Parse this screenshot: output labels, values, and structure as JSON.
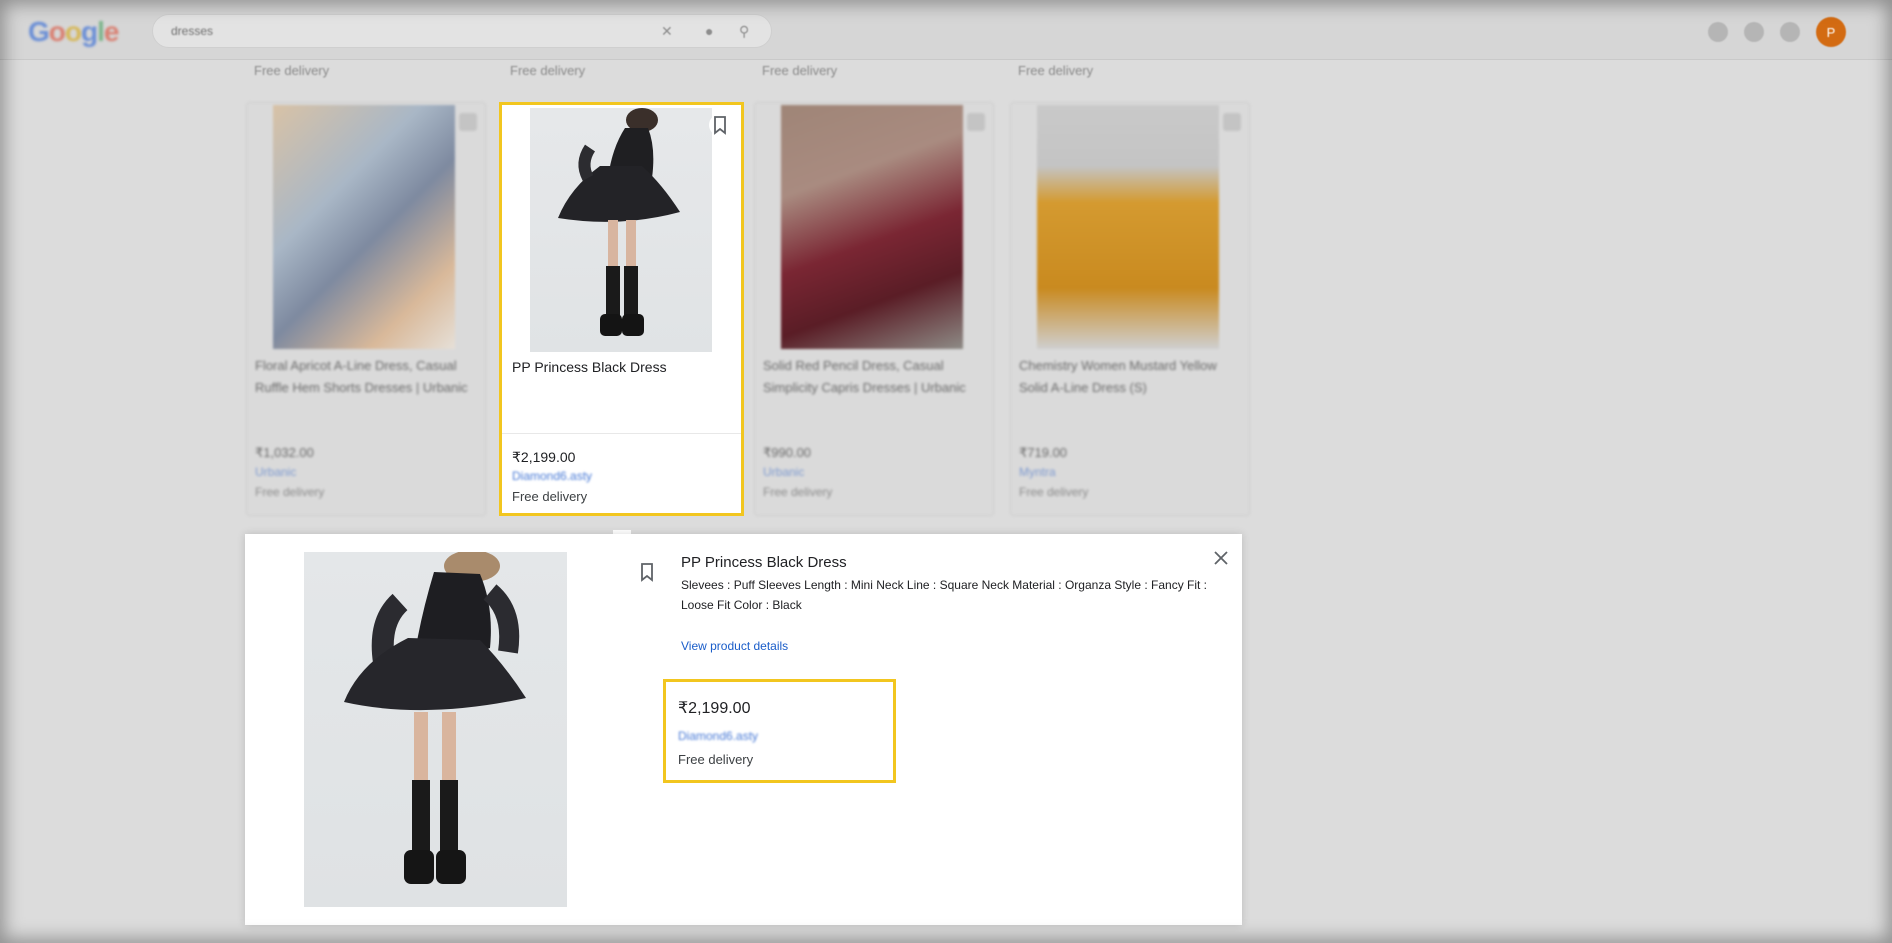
{
  "header": {
    "logo_letters": [
      "G",
      "o",
      "o",
      "g",
      "l",
      "e"
    ],
    "search_query": "dresses",
    "avatar_letter": "P"
  },
  "grid": {
    "top_row": [
      {
        "delivery": "Free delivery"
      },
      {
        "delivery": "Free delivery"
      },
      {
        "delivery": "Free delivery"
      },
      {
        "delivery": "Free delivery"
      }
    ],
    "cards": [
      {
        "title": "Floral Apricot A-Line Dress, Casual Ruffle Hem Shorts Dresses | Urbanic",
        "price": "₹1,032.00",
        "seller": "Urbanic",
        "delivery": "Free delivery",
        "image_tone": "floral"
      },
      {
        "title": "PP Princess Black Dress",
        "price": "₹2,199.00",
        "seller": "Diamond6.asty",
        "delivery": "Free delivery",
        "selected": true
      },
      {
        "title": "Solid Red Pencil Dress, Casual Simplicity Capris Dresses | Urbanic",
        "price": "₹990.00",
        "seller": "Urbanic",
        "delivery": "Free delivery",
        "image_tone": "red"
      },
      {
        "title": "Chemistry Women Mustard Yellow Solid A-Line Dress (S)",
        "price": "₹719.00",
        "seller": "Myntra",
        "delivery": "Free delivery",
        "image_tone": "mustard"
      }
    ]
  },
  "panel": {
    "title": "PP Princess Black Dress",
    "description": "Slevees : Puff Sleeves Length : Mini Neck Line : Square Neck Material : Organza Style : Fancy Fit : Loose Fit Color : Black",
    "view_details": "View product details",
    "offer": {
      "price": "₹2,199.00",
      "seller": "Diamond6.asty",
      "delivery": "Free delivery"
    }
  },
  "colors": {
    "highlight": "#f2c61f",
    "link": "#1a5dc9"
  }
}
